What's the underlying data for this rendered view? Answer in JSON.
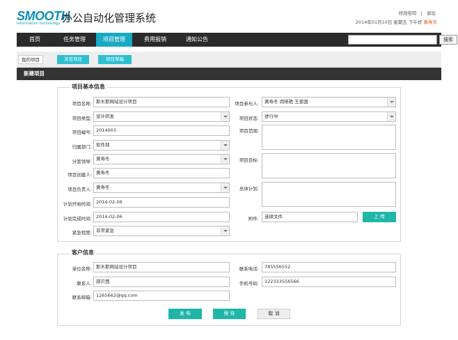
{
  "brand": {
    "logo": "SMOOTH",
    "logo_sub": "Information technology",
    "title": "办公自动化管理系统"
  },
  "top": {
    "change_password": "修改密码",
    "separator": "|",
    "logout": "退出",
    "date": "2014年01月10日 星期五 下午好",
    "user": "黄寿东"
  },
  "nav": {
    "items": [
      "首页",
      "任务管理",
      "项目管理",
      "费用报销",
      "通知公告"
    ],
    "active": "项目管理",
    "search_button": "搜索",
    "search_value": ""
  },
  "subtabs": [
    "我的项目",
    "浏览项目",
    "项目草稿"
  ],
  "section_title": "新建项目",
  "basic": {
    "legend": "项目基本信息",
    "name_label": "项目名称:",
    "name_value": "斯木斯网站设计项目",
    "type_label": "项目类型:",
    "type_value": "设计研发",
    "number_label": "项目编号:",
    "number_value": "2014003",
    "dept_label": "归属部门:",
    "dept_value": "软件部",
    "leader_label": "分管领导:",
    "leader_value": "黄寿冬",
    "creator_label": "项目创建人:",
    "creator_value": "黄寿冬",
    "owner_label": "项目负责人:",
    "owner_value": "黄寿冬",
    "start_label": "计划开始时间:",
    "start_value": "2014-02-06",
    "end_label": "计划完成时间:",
    "end_value": "2014-02-06",
    "urgency_label": "紧急程度:",
    "urgency_value": "非常紧急",
    "members_label": "项目参与人:",
    "members_value": "黄寿冬 闵晓艳 王爱国",
    "status_label": "项目状态:",
    "status_value": "进行中",
    "scope_label": "项目范围:",
    "goal_label": "项目目标:",
    "plan_label": "总体计划:",
    "attach_label": "附件:",
    "attach_value": "选择文件",
    "upload_button": "上 传"
  },
  "client": {
    "legend": "客户信息",
    "company_label": "单位名称:",
    "company_value": "斯木斯网站设计项目",
    "contact_label": "联系人:",
    "contact_value": "邵贝茜",
    "email_label": "联系邮箱:",
    "email_value": "1265662@qq.com",
    "phone_label": "联系电话:",
    "phone_value": "785556552",
    "mobile_label": "手机号码:",
    "mobile_value": "122333556566"
  },
  "actions": {
    "publish": "发 布",
    "save": "保 存",
    "cancel": "取 消"
  },
  "colors": {
    "accent": "#18a9c4",
    "button": "#1fb6a8",
    "nav_bg": "#2b2b2b",
    "user": "#e05a1d"
  }
}
